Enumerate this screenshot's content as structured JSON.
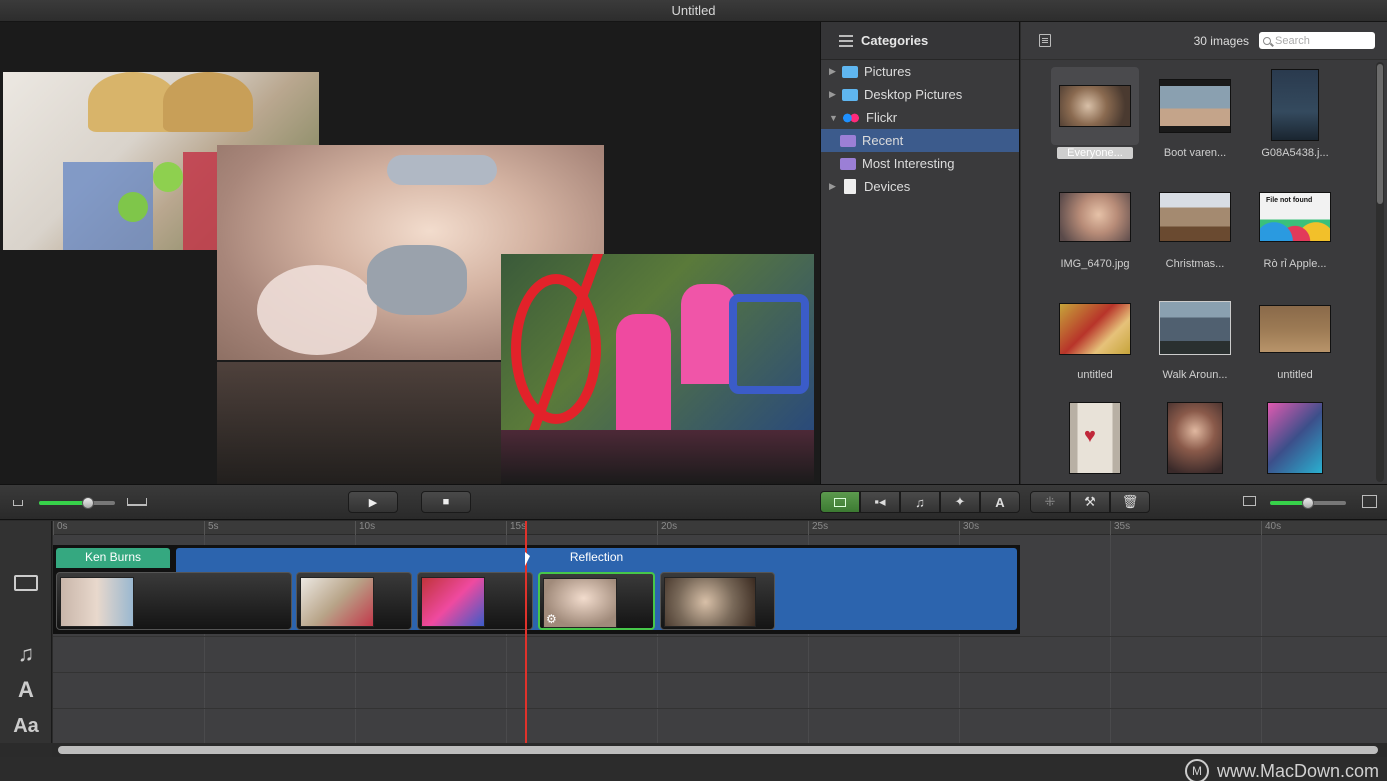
{
  "window": {
    "title": "Untitled"
  },
  "sidebar": {
    "header": "Categories",
    "items": [
      {
        "label": "Pictures",
        "icon": "folder-icon",
        "color": "#5fb6f0",
        "expandable": true
      },
      {
        "label": "Desktop Pictures",
        "icon": "folder-icon",
        "color": "#5fb6f0",
        "expandable": true
      },
      {
        "label": "Flickr",
        "icon": "flickr-icon",
        "color": "#e8326c",
        "expanded": true
      },
      {
        "label": "Recent",
        "icon": "smart-folder-icon",
        "color": "#9b7fd6",
        "selected": true
      },
      {
        "label": "Most Interesting",
        "icon": "smart-folder-icon",
        "color": "#9b7fd6"
      },
      {
        "label": "Devices",
        "icon": "document-icon",
        "color": "#eeeeee",
        "expandable": true
      }
    ]
  },
  "browser": {
    "count": "30 images",
    "search_placeholder": "Search",
    "thumbs": [
      {
        "label": "Everyone...",
        "color": "#7a6a5a",
        "selected": true
      },
      {
        "label": "Boot varen...",
        "color": "#8aa0b0"
      },
      {
        "label": "G08A5438.j...",
        "color": "#344a5e"
      },
      {
        "label": "IMG_6470.jpg",
        "color": "#b88c78"
      },
      {
        "label": "Christmas...",
        "color": "#a48a70"
      },
      {
        "label": "Rò rỉ Apple...",
        "color": "#f2f2f2"
      },
      {
        "label": "untitled",
        "color": "#c6a43a"
      },
      {
        "label": "Walk Aroun...",
        "color": "#506070"
      },
      {
        "label": "untitled",
        "color": "#9c7a54"
      },
      {
        "label": "",
        "color": "#d6cfc4"
      },
      {
        "label": "",
        "color": "#6a4f4a"
      },
      {
        "label": "",
        "color": "#3c4f8a"
      }
    ],
    "file_not_found": "File not found"
  },
  "toolbar": {
    "play": "▶",
    "stop": "■",
    "segments": [
      "photo",
      "video",
      "music",
      "effects",
      "text"
    ],
    "tools": [
      "align",
      "wrench",
      "trash"
    ]
  },
  "timeline": {
    "ticks": [
      "0s",
      "5s",
      "10s",
      "15s",
      "20s",
      "25s",
      "30s",
      "35s",
      "40s"
    ],
    "transitions": {
      "ken_burns": "Ken Burns",
      "reflection": "Reflection"
    },
    "clips": [
      {
        "color": "#c9b6aa"
      },
      {
        "color": "#b8a488"
      },
      {
        "color": "#c0343a"
      },
      {
        "color": "#a08a7a"
      },
      {
        "color": "#7a6a5a"
      }
    ]
  },
  "watermark": {
    "text": "www.MacDown.com",
    "logo": "M"
  }
}
